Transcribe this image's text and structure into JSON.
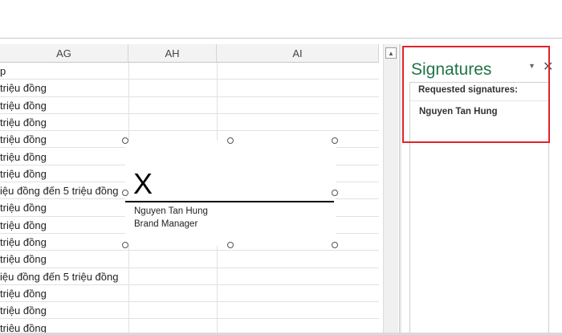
{
  "grid": {
    "columns": [
      {
        "label": "AG"
      },
      {
        "label": "AH"
      },
      {
        "label": "AI"
      }
    ],
    "rows": [
      "p",
      "triệu đồng",
      "triệu đồng",
      "triệu đồng",
      "triệu đồng",
      "triệu đồng",
      "triệu đồng",
      "iệu đồng đến 5 triệu đồng",
      "triệu đồng",
      "triệu đồng",
      "triệu đồng",
      "triệu đồng",
      "iệu đồng đến 5 triệu đồng",
      "triệu đồng",
      "triệu đồng",
      "triệu đồng"
    ]
  },
  "signature_line": {
    "mark": "X",
    "signer_name": "Nguyen Tan Hung",
    "signer_title": "Brand Manager"
  },
  "signatures_pane": {
    "title": "Signatures",
    "menu_icon": "dropdown-triangle-icon",
    "close_icon": "close-icon",
    "requested_label": "Requested signatures:",
    "requested": [
      "Nguyen Tan Hung"
    ]
  },
  "scrollbar": {
    "up_icon": "triangle-up-icon"
  },
  "colors": {
    "pane_title": "#217346",
    "highlight": "#e2232a",
    "header_bg": "#f3f3f3"
  }
}
